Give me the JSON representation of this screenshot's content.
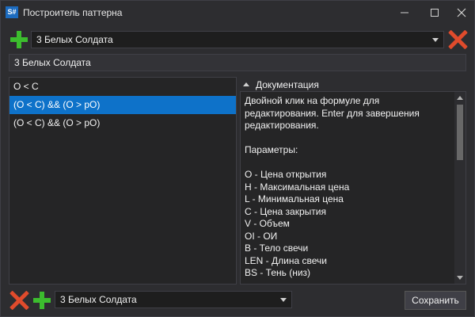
{
  "window": {
    "icon_text": "S#",
    "title": "Построитель паттерна",
    "minimize_glyph": "—",
    "maximize_glyph": "☐",
    "close_glyph": "✕"
  },
  "top": {
    "pattern_select_value": "3 Белых Солдата"
  },
  "name_field": {
    "value": "3 Белых Солдата"
  },
  "formulas": [
    "O < C",
    "(O < C) && (O > pO)",
    "(O < C) && (O > pO)"
  ],
  "selected_formula_index": 1,
  "documentation": {
    "header": "Документация",
    "text": "Двойной клик на формуле для редактирования. Enter для завершения редактирования.\n\nПараметры:\n\nO - Цена открытия\nH - Максимальная цена\nL - Минимальная цена\nC - Цена закрытия\nV - Объем\nOI - ОИ\nB - Тело свечи\nLEN - Длина свечи\nBS - Тень (низ)"
  },
  "bottom": {
    "pattern_select_value": "3 Белых Солдата",
    "save_label": "Сохранить"
  },
  "colors": {
    "background": "#2d2d30",
    "selection": "#0e72c9",
    "add": "#3cbd2e",
    "remove": "#e04b2c"
  },
  "icons": [
    "add-icon",
    "delete-icon",
    "minimize-icon",
    "maximize-icon",
    "close-icon",
    "chevron-down-icon",
    "collapse-triangle-icon"
  ]
}
